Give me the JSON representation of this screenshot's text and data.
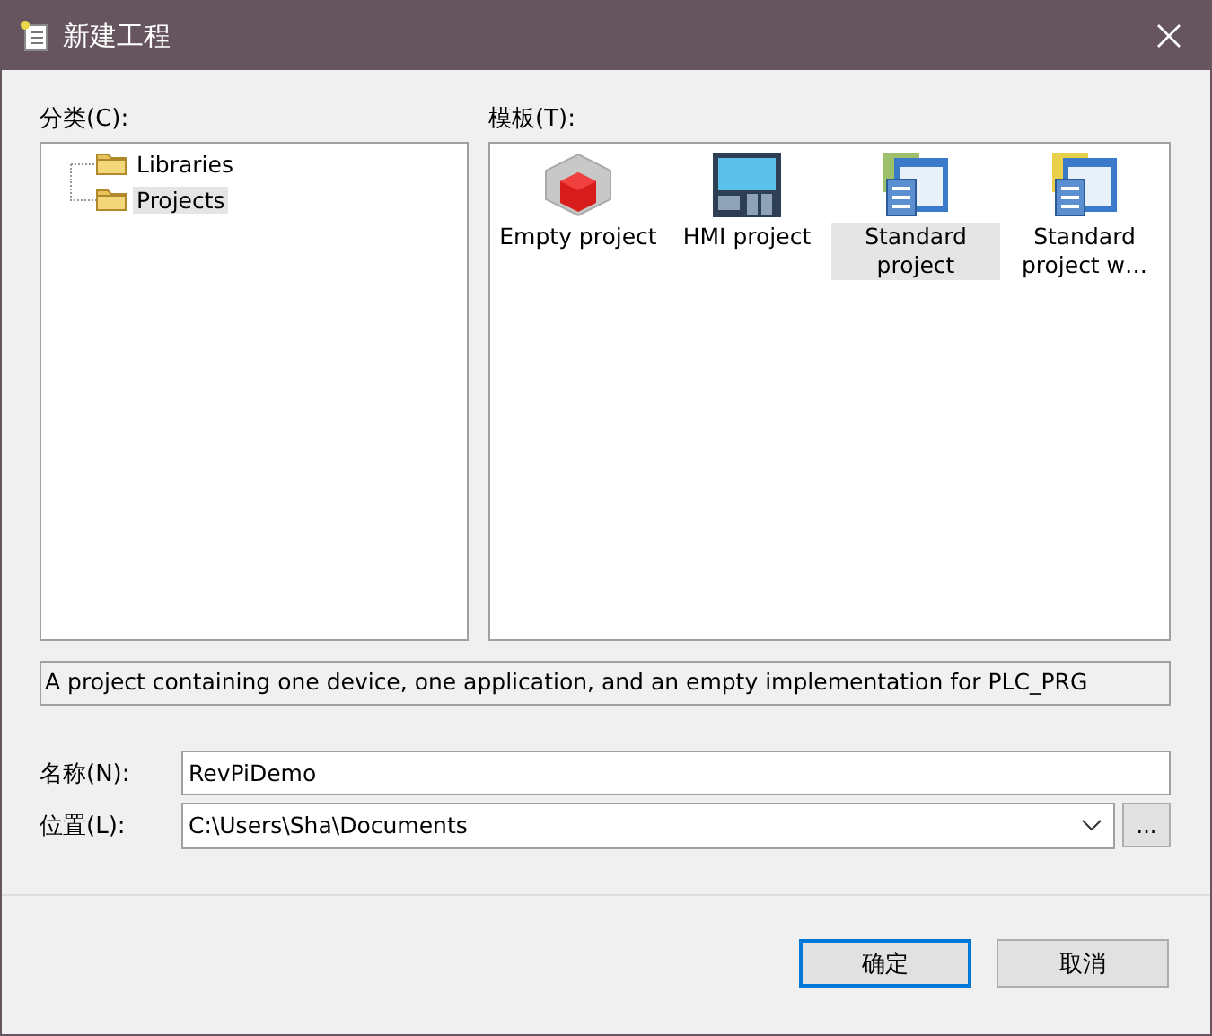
{
  "window": {
    "title": "新建工程"
  },
  "categories": {
    "label": "分类(C):",
    "items": [
      {
        "label": "Libraries",
        "selected": false
      },
      {
        "label": "Projects",
        "selected": true
      }
    ]
  },
  "templates": {
    "label": "模板(T):",
    "items": [
      {
        "kind": "cube",
        "label": "Empty project",
        "selected": false
      },
      {
        "kind": "hmi",
        "label": "HMI project",
        "selected": false
      },
      {
        "kind": "standard",
        "label": "Standard project",
        "selected": true
      },
      {
        "kind": "standard-plus",
        "label": "Standard project w…",
        "selected": false
      }
    ]
  },
  "description": "A project containing one device, one application, and an empty implementation for PLC_PRG",
  "name_field": {
    "label": "名称(N):",
    "value": "RevPiDemo"
  },
  "location_field": {
    "label": "位置(L):",
    "value": "C:\\Users\\Sha\\Documents",
    "browse": "..."
  },
  "buttons": [
    {
      "label": "确定",
      "default": true
    },
    {
      "label": "取消",
      "default": false
    }
  ]
}
